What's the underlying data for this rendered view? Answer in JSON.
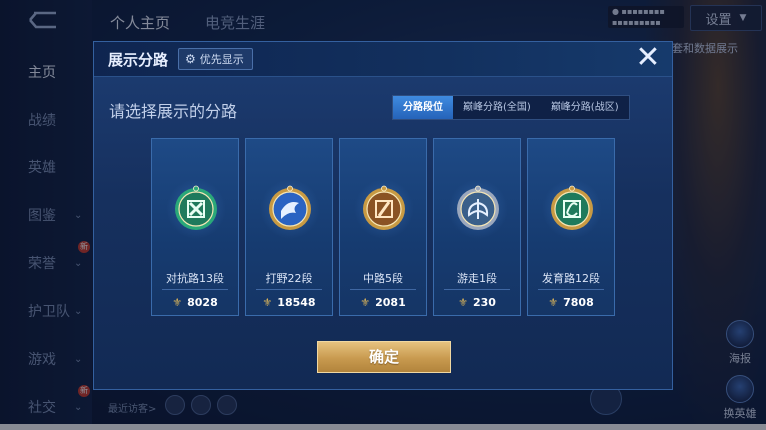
{
  "background": {
    "tabs": [
      "个人主页",
      "电竞生涯"
    ],
    "nav": [
      {
        "label": "主页",
        "active": true,
        "chevron": false,
        "badge": ""
      },
      {
        "label": "战绩",
        "active": false,
        "chevron": false,
        "badge": ""
      },
      {
        "label": "英雄",
        "active": false,
        "chevron": false,
        "badge": ""
      },
      {
        "label": "图鉴",
        "active": false,
        "chevron": true,
        "badge": ""
      },
      {
        "label": "荣誉",
        "active": false,
        "chevron": true,
        "badge": "新"
      },
      {
        "label": "护卫队",
        "active": false,
        "chevron": true,
        "badge": ""
      },
      {
        "label": "游戏",
        "active": false,
        "chevron": true,
        "badge": ""
      },
      {
        "label": "社交",
        "active": false,
        "chevron": true,
        "badge": "新"
      }
    ],
    "settings_label": "设置",
    "peek_text": "套和数据展示",
    "haifu_label": "海报",
    "huan_label": "换英雄",
    "recent_label": "最近访客>"
  },
  "modal": {
    "title": "展示分路",
    "priority_label": "优先显示",
    "close_symbol": "✕",
    "subtitle": "请选择展示的分路",
    "segments": [
      {
        "label": "分路段位",
        "active": true
      },
      {
        "label": "巅峰分路(全国)",
        "active": false
      },
      {
        "label": "巅峰分路(战区)",
        "active": false
      }
    ],
    "cards": [
      {
        "name": "对抗路13段",
        "score": "8028",
        "icon": "sword-emblem-icon",
        "ring": "#2aa879",
        "inner": "#1f7a5c"
      },
      {
        "name": "打野22段",
        "score": "18548",
        "icon": "dragon-emblem-icon",
        "ring": "#c89a43",
        "inner": "#2a63c2"
      },
      {
        "name": "中路5段",
        "score": "2081",
        "icon": "slash-emblem-icon",
        "ring": "#c89a43",
        "inner": "#8a5324"
      },
      {
        "name": "游走1段",
        "score": "230",
        "icon": "wing-emblem-icon",
        "ring": "#9aa7bd",
        "inner": "#3a5f8a"
      },
      {
        "name": "发育路12段",
        "score": "7808",
        "icon": "bow-emblem-icon",
        "ring": "#c89a43",
        "inner": "#1f7a5c"
      }
    ],
    "confirm_label": "确定"
  }
}
